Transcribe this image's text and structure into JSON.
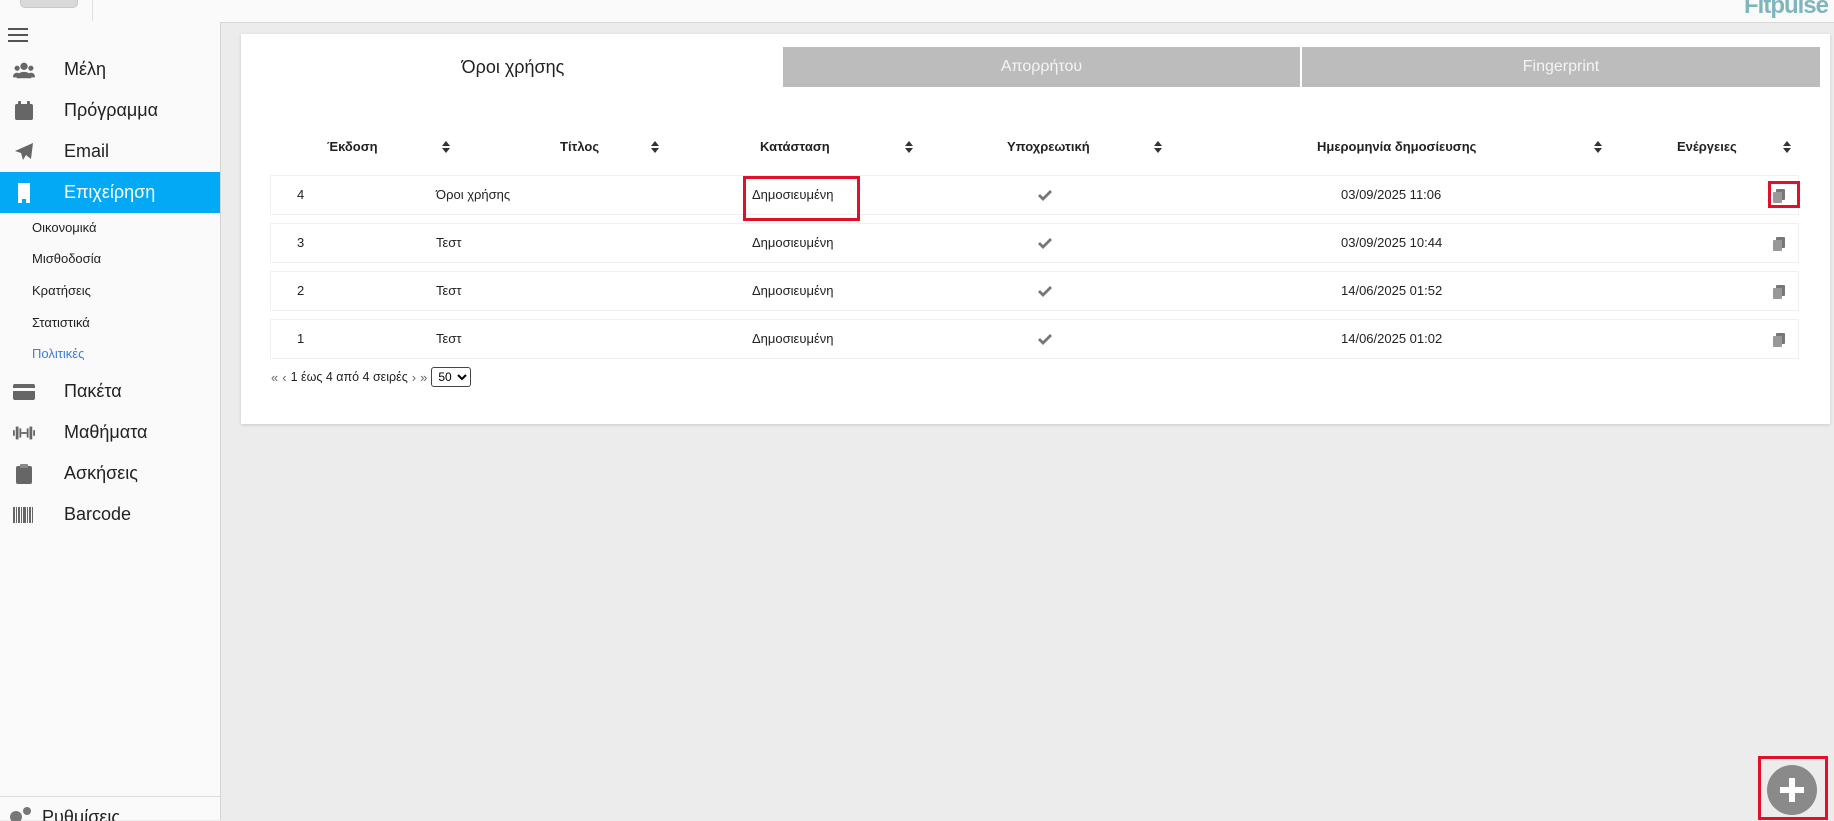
{
  "brand": "Fitpulse",
  "sidebar": {
    "items": [
      {
        "label": "Μέλη",
        "icon": "users-icon"
      },
      {
        "label": "Πρόγραμμα",
        "icon": "calendar-icon"
      },
      {
        "label": "Email",
        "icon": "paper-plane-icon"
      },
      {
        "label": "Επιχείρηση",
        "icon": "building-icon",
        "active": true
      },
      {
        "label": "Πακέτα",
        "icon": "credit-card-icon"
      },
      {
        "label": "Μαθήματα",
        "icon": "dumbbell-icon"
      },
      {
        "label": "Ασκήσεις",
        "icon": "clipboard-icon"
      },
      {
        "label": "Barcode",
        "icon": "barcode-icon"
      }
    ],
    "sub_items": [
      "Οικονομικά",
      "Μισθοδοσία",
      "Κρατήσεις",
      "Στατιστικά",
      "Πολιτικές"
    ],
    "bottom_label": "Ρυθμίσεις"
  },
  "tabs": [
    "Όροι χρήσης",
    "Απορρήτου",
    "Fingerprint"
  ],
  "table": {
    "columns": [
      "Έκδοση",
      "Τίτλος",
      "Κατάσταση",
      "Υποχρεωτική",
      "Ημερομηνία δημοσίευσης",
      "Ενέργειες"
    ],
    "rows": [
      {
        "version": "4",
        "title": "Όροι χρήσης",
        "status": "Δημοσιευμένη",
        "mandatory": true,
        "date": "03/09/2025 11:06"
      },
      {
        "version": "3",
        "title": "Τεστ",
        "status": "Δημοσιευμένη",
        "mandatory": true,
        "date": "03/09/2025 10:44"
      },
      {
        "version": "2",
        "title": "Τεστ",
        "status": "Δημοσιευμένη",
        "mandatory": true,
        "date": "14/06/2025 01:52"
      },
      {
        "version": "1",
        "title": "Τεστ",
        "status": "Δημοσιευμένη",
        "mandatory": true,
        "date": "14/06/2025 01:02"
      }
    ]
  },
  "pager": {
    "first": "«",
    "prev": "‹",
    "summary": "1 έως 4 από 4 σειρές",
    "next": "›",
    "last": "»",
    "page_size": "50"
  },
  "colors": {
    "accent": "#03a9f4",
    "highlight": "#e0102a",
    "fab": "#8a8a8a"
  }
}
